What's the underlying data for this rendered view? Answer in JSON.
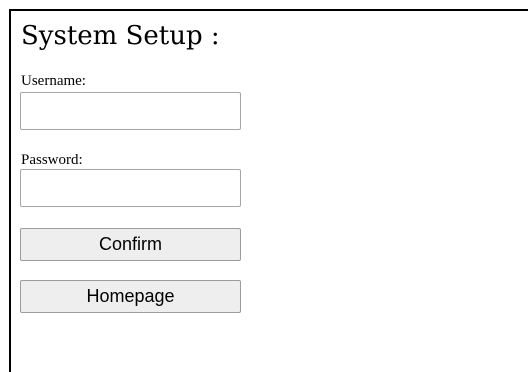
{
  "page": {
    "title": "System Setup :"
  },
  "form": {
    "username": {
      "label": "Username:",
      "value": "",
      "placeholder": ""
    },
    "password": {
      "label": "Password:",
      "value": "",
      "placeholder": ""
    }
  },
  "buttons": {
    "confirm_label": "Confirm",
    "homepage_label": "Homepage"
  }
}
